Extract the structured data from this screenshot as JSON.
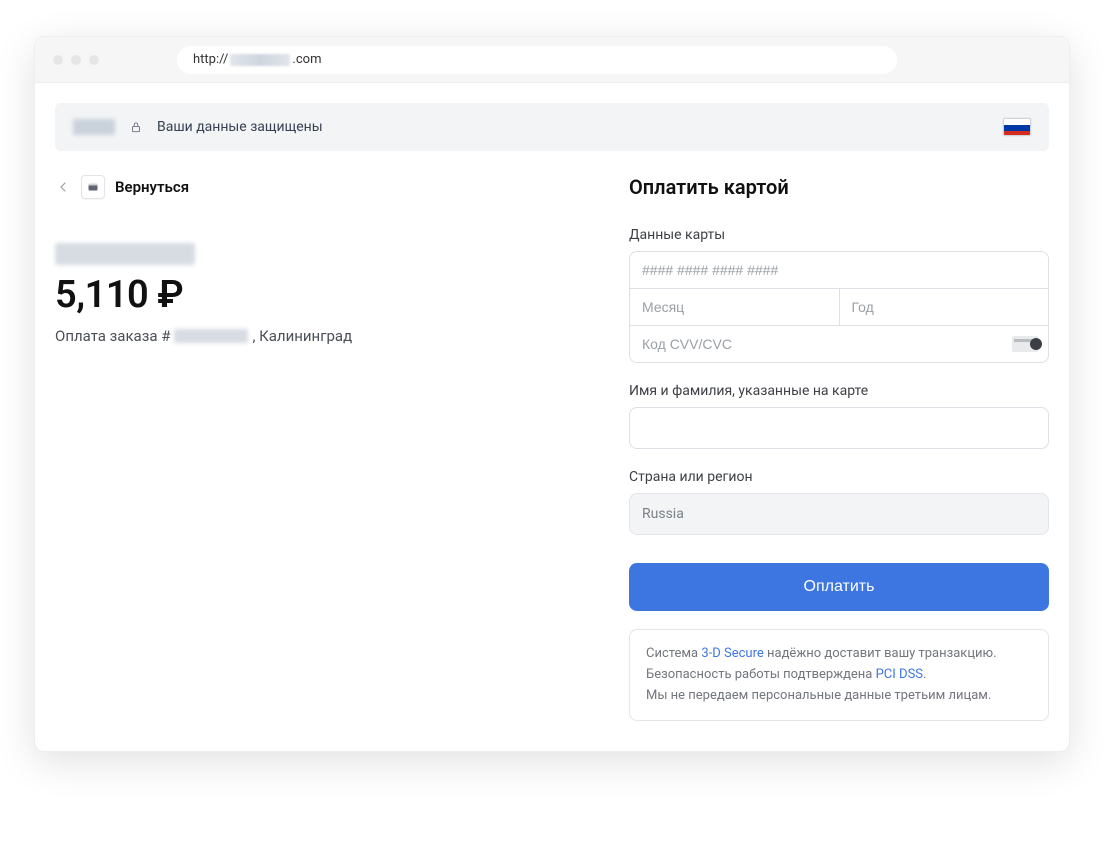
{
  "browser": {
    "url_prefix": "http://",
    "url_suffix": ".com"
  },
  "topbar": {
    "protected_text": "Ваши данные защищены",
    "flag_name": "russia-flag"
  },
  "back": {
    "label": "Вернуться"
  },
  "order": {
    "amount": "5,110 ₽",
    "desc_prefix": "Оплата заказа #",
    "desc_suffix": ", Калининград"
  },
  "pay": {
    "title": "Оплатить картой",
    "card_label": "Данные карты",
    "card_number_placeholder": "#### #### #### ####",
    "month_placeholder": "Месяц",
    "year_placeholder": "Год",
    "cvv_placeholder": "Код CVV/CVC",
    "name_label": "Имя и фамилия, указанные на карте",
    "country_label": "Страна или регион",
    "country_value": "Russia",
    "button_label": "Оплатить"
  },
  "security": {
    "line1_a": "Система ",
    "line1_link": "3-D Secure",
    "line1_b": " надёжно доставит вашу транзакцию.",
    "line2_a": "Безопасность работы подтверждена ",
    "line2_link": "PCI DSS",
    "line2_b": ".",
    "line3": "Мы не передаем персональные данные третьим лицам."
  }
}
